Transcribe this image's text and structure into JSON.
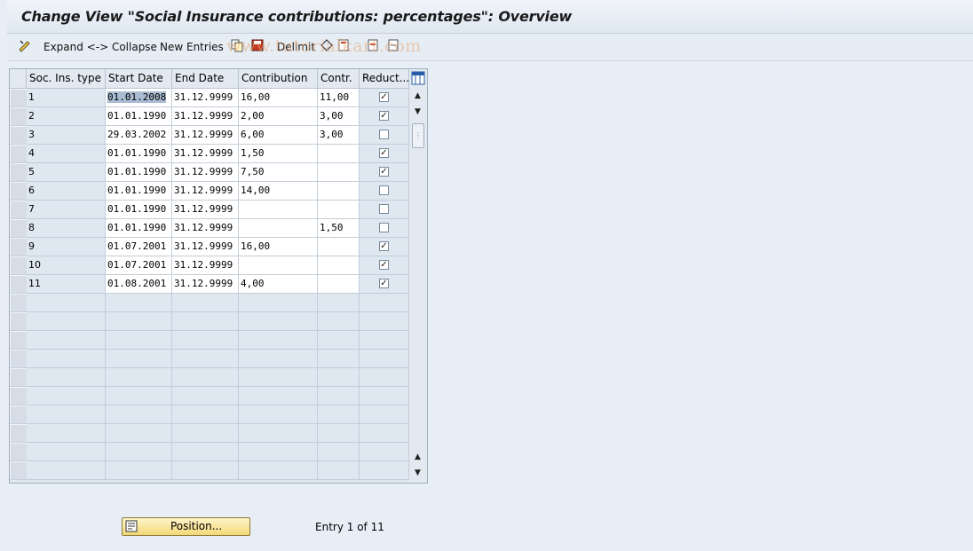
{
  "window": {
    "title": "Change View \"Social Insurance contributions: percentages\": Overview"
  },
  "toolbar": {
    "expand_collapse": "Expand <-> Collapse",
    "new_entries": "New Entries",
    "delimit": "Delimit",
    "watermark": "www.tutorialkart.com"
  },
  "table": {
    "headers": [
      "Soc. Ins. type",
      "Start Date",
      "End Date",
      "Contribution",
      "Contr.",
      "Reduct..."
    ],
    "rows": [
      {
        "type": "1",
        "start": "01.01.2008",
        "end": "31.12.9999",
        "contribution": "16,00",
        "contr": "11,00",
        "reduct": true
      },
      {
        "type": "2",
        "start": "01.01.1990",
        "end": "31.12.9999",
        "contribution": "2,00",
        "contr": "3,00",
        "reduct": true
      },
      {
        "type": "3",
        "start": "29.03.2002",
        "end": "31.12.9999",
        "contribution": "6,00",
        "contr": "3,00",
        "reduct": false
      },
      {
        "type": "4",
        "start": "01.01.1990",
        "end": "31.12.9999",
        "contribution": "1,50",
        "contr": "",
        "reduct": true
      },
      {
        "type": "5",
        "start": "01.01.1990",
        "end": "31.12.9999",
        "contribution": "7,50",
        "contr": "",
        "reduct": true
      },
      {
        "type": "6",
        "start": "01.01.1990",
        "end": "31.12.9999",
        "contribution": "14,00",
        "contr": "",
        "reduct": false
      },
      {
        "type": "7",
        "start": "01.01.1990",
        "end": "31.12.9999",
        "contribution": "",
        "contr": "",
        "reduct": false
      },
      {
        "type": "8",
        "start": "01.01.1990",
        "end": "31.12.9999",
        "contribution": "",
        "contr": "1,50",
        "reduct": false
      },
      {
        "type": "9",
        "start": "01.07.2001",
        "end": "31.12.9999",
        "contribution": "16,00",
        "contr": "",
        "reduct": true
      },
      {
        "type": "10",
        "start": "01.07.2001",
        "end": "31.12.9999",
        "contribution": "",
        "contr": "",
        "reduct": true
      },
      {
        "type": "11",
        "start": "01.08.2001",
        "end": "31.12.9999",
        "contribution": "4,00",
        "contr": "",
        "reduct": true
      }
    ],
    "empty_rows": 10
  },
  "footer": {
    "position_button": "Position...",
    "entry_status": "Entry 1 of 11"
  }
}
